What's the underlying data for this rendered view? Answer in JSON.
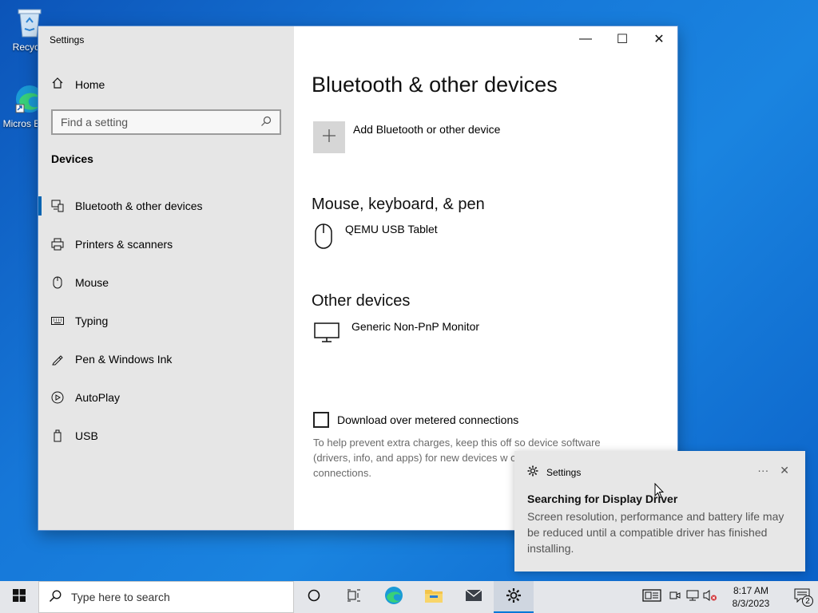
{
  "desktop": {
    "icons": [
      {
        "label": "Recycle",
        "icon": "recycle-bin-icon"
      },
      {
        "label": "Micros Edge",
        "icon": "edge-icon"
      }
    ]
  },
  "window": {
    "title": "Settings",
    "sidebar": {
      "home_label": "Home",
      "search_placeholder": "Find a setting",
      "section": "Devices",
      "items": [
        {
          "label": "Bluetooth & other devices",
          "icon": "bluetooth-devices-icon",
          "active": true
        },
        {
          "label": "Printers & scanners",
          "icon": "printer-icon"
        },
        {
          "label": "Mouse",
          "icon": "mouse-icon"
        },
        {
          "label": "Typing",
          "icon": "keyboard-icon"
        },
        {
          "label": "Pen & Windows Ink",
          "icon": "pen-icon"
        },
        {
          "label": "AutoPlay",
          "icon": "autoplay-icon"
        },
        {
          "label": "USB",
          "icon": "usb-icon"
        }
      ]
    },
    "content": {
      "title": "Bluetooth & other devices",
      "add_label": "Add Bluetooth or other device",
      "section_mouse": "Mouse, keyboard, & pen",
      "mouse_device": "QEMU USB Tablet",
      "section_other": "Other devices",
      "other_device": "Generic Non-PnP Monitor",
      "metered_label": "Download over metered connections",
      "metered_help": "To help prevent extra charges, keep this off so device software (drivers, info, and apps) for new devices w on metered Internet connections."
    }
  },
  "toast": {
    "app": "Settings",
    "title": "Searching for Display Driver",
    "body": "Screen resolution, performance and battery life may be reduced until a compatible driver has finished installing."
  },
  "taskbar": {
    "search_placeholder": "Type here to search",
    "time": "8:17 AM",
    "date": "8/3/2023",
    "notifications": "2"
  },
  "colors": {
    "accent": "#0063b1",
    "taskbar_active": "#0078d7"
  }
}
